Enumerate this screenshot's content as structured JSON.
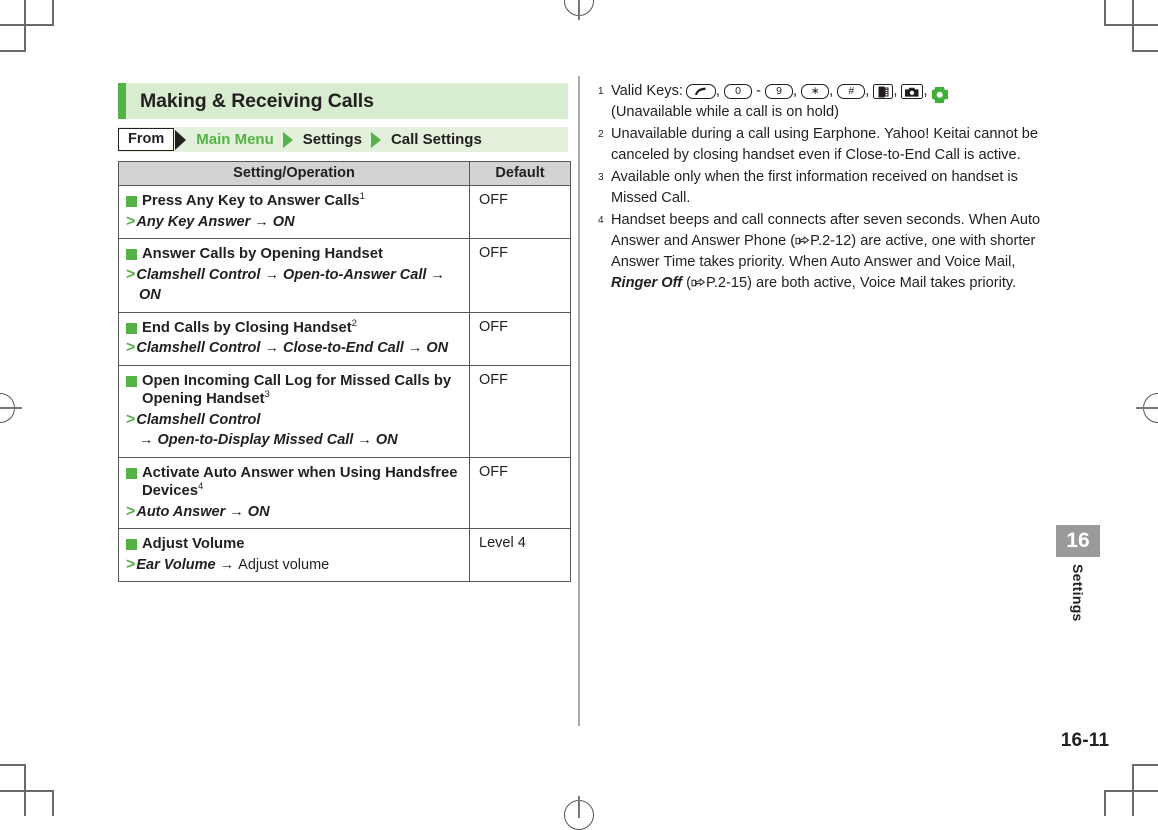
{
  "section": {
    "title": "Making & Receiving Calls"
  },
  "breadcrumb": {
    "from_label": "From",
    "items": [
      {
        "label": "Main Menu",
        "style": "green"
      },
      {
        "label": "Settings",
        "style": "dark"
      },
      {
        "label": "Call Settings",
        "style": "dark"
      }
    ]
  },
  "table": {
    "headers": {
      "operation": "Setting/Operation",
      "default": "Default"
    },
    "rows": [
      {
        "title": "Press Any Key to Answer Calls",
        "footnote_ref": "1",
        "path": "Any Key Answer → ON",
        "path_line2": "",
        "default": "OFF"
      },
      {
        "title": "Answer Calls by Opening Handset",
        "footnote_ref": "",
        "path": "Clamshell Control → Open-to-Answer Call →",
        "path_line2": "ON",
        "default": "OFF"
      },
      {
        "title": "End Calls by Closing Handset",
        "footnote_ref": "2",
        "path": "Clamshell Control → Close-to-End Call → ON",
        "path_line2": "",
        "default": "OFF"
      },
      {
        "title": "Open Incoming Call Log for Missed Calls by Opening Handset",
        "footnote_ref": "3",
        "path": "Clamshell Control",
        "path_line2": "→ Open-to-Display Missed Call → ON",
        "default": "OFF"
      },
      {
        "title": "Activate Auto Answer when Using Handsfree Devices",
        "footnote_ref": "4",
        "path": "Auto Answer → ON",
        "path_line2": "",
        "default": "OFF"
      },
      {
        "title": "Adjust Volume",
        "footnote_ref": "",
        "path": "Ear Volume → ",
        "path_plain": "Adjust volume",
        "path_line2": "",
        "default": "Level 4"
      }
    ]
  },
  "footnotes": [
    {
      "num": "1",
      "lead": "Valid Keys:",
      "keys": [
        "call-key",
        "0",
        "-",
        "9",
        "∗",
        "#",
        "memo-key",
        "camera-key",
        "nav-key"
      ],
      "line2": "(Unavailable while a call is on hold)"
    },
    {
      "num": "2",
      "text": "Unavailable during a call using Earphone. Yahoo! Keitai cannot be canceled by closing handset even if Close-to-End Call is active."
    },
    {
      "num": "3",
      "text": "Available only when the first information received on handset is Missed Call."
    },
    {
      "num": "4",
      "text_part1": "Handset beeps and call connects after seven seconds. When Auto Answer and Answer Phone (",
      "ref1": "P.2-12",
      "text_part2": ") are active, one with shorter Answer Time takes priority. When Auto Answer and Voice Mail, ",
      "emphasis": "Ringer Off",
      "text_part3": " (",
      "ref2": "P.2-15",
      "text_part4": ") are both active, Voice Mail takes priority."
    }
  ],
  "chapter": {
    "number": "16",
    "label": "Settings"
  },
  "page_number": "16-11",
  "colors": {
    "accent_green": "#55b247",
    "title_bg": "#d8ecd0",
    "breadcrumb_bg": "#e3f0db",
    "table_header_bg": "#d3d3d3",
    "chapter_tab_bg": "#9a9a9a"
  }
}
